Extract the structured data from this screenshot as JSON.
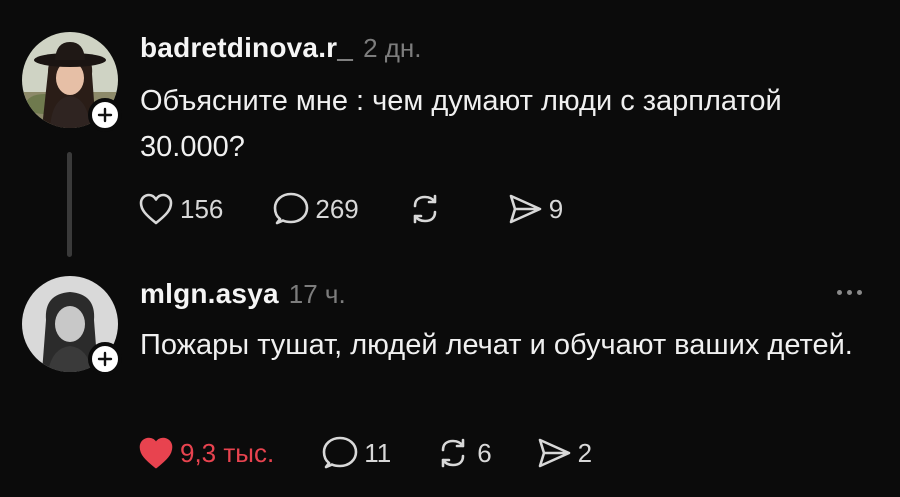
{
  "posts": [
    {
      "username": "badretdinova.r_",
      "time": "2 дн.",
      "text": "Объясните мне : чем думают люди с зарплатой 30.000?",
      "actions": {
        "likes": "156",
        "comments": "269",
        "reposts": "",
        "shares": "9"
      },
      "liked": false
    },
    {
      "username": "mlgn.asya",
      "time": "17 ч.",
      "text": "Пожары тушат, людей лечат и обучают ваших детей.",
      "actions": {
        "likes": "9,3 тыс.",
        "comments": "11",
        "reposts": "6",
        "shares": "2"
      },
      "liked": true
    }
  ],
  "icons": {
    "like": "heart-icon",
    "comment": "speech-bubble-icon",
    "repost": "repost-arrows-icon",
    "share": "send-icon",
    "follow": "plus-icon",
    "more": "more-dots-icon"
  },
  "colors": {
    "background": "#0b0b0b",
    "text": "#f0f0f0",
    "muted": "#7d7d7d",
    "liked": "#e8434f"
  }
}
